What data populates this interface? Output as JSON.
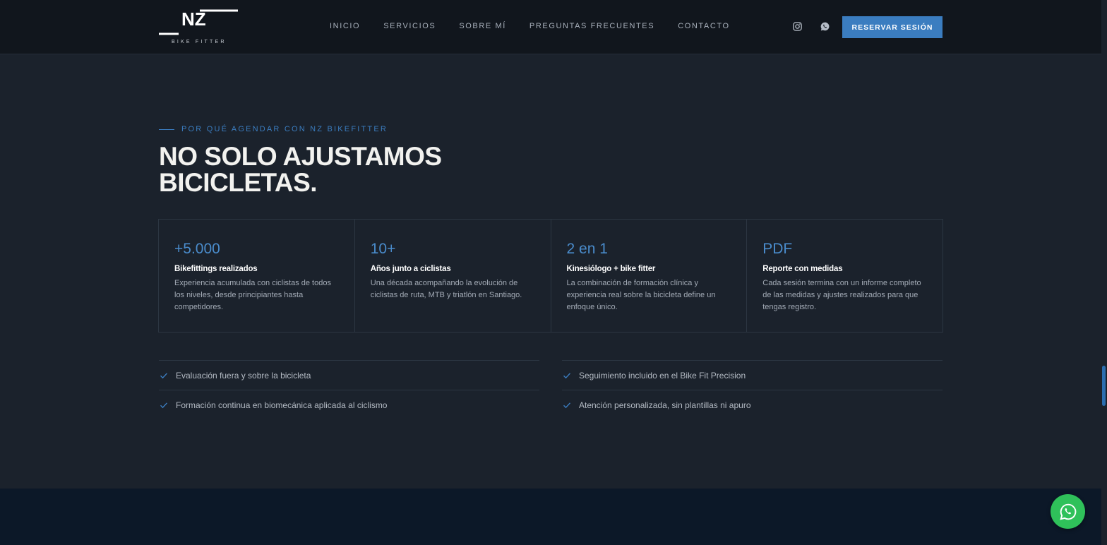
{
  "header": {
    "logo_text": "NZ",
    "logo_subtext": "BIKE FITTER",
    "nav": [
      {
        "label": "INICIO"
      },
      {
        "label": "SERVICIOS"
      },
      {
        "label": "SOBRE MÍ"
      },
      {
        "label": "PREGUNTAS FRECUENTES"
      },
      {
        "label": "CONTACTO"
      }
    ],
    "cta_label": "RESERVAR SESIÓN"
  },
  "section": {
    "eyebrow": "POR QUÉ AGENDAR CON NZ BIKEFITTER",
    "title_line1": "NO SOLO AJUSTAMOS",
    "title_line2": "BICICLETAS.",
    "stats": [
      {
        "num": "+5.000",
        "label": "Bikefittings realizados",
        "desc": "Experiencia acumulada con ciclistas de todos los niveles, desde principiantes hasta competidores."
      },
      {
        "num": "10+",
        "label": "Años junto a ciclistas",
        "desc": "Una década acompañando la evolución de ciclistas de ruta, MTB y triatlón en Santiago."
      },
      {
        "num": "2 en 1",
        "label": "Kinesiólogo + bike fitter",
        "desc": "La combinación de formación clínica y experiencia real sobre la bicicleta define un enfoque único."
      },
      {
        "num": "PDF",
        "label": "Reporte con medidas",
        "desc": "Cada sesión termina con un informe completo de las medidas y ajustes realizados para que tengas registro."
      }
    ],
    "checks": [
      "Evaluación fuera y sobre la bicicleta",
      "Seguimiento incluido en el Bike Fit Precision",
      "Formación continua en biomecánica aplicada al ciclismo",
      "Atención personalizada, sin plantillas ni apuro"
    ]
  },
  "colors": {
    "accent": "#3b7dc0",
    "background": "#1b222c",
    "header_bg": "#11161d",
    "whatsapp": "#2fc15a"
  },
  "icons": {
    "social": [
      "instagram-icon",
      "whatsapp-icon"
    ],
    "check": "check-icon",
    "floating": "whatsapp-icon"
  }
}
